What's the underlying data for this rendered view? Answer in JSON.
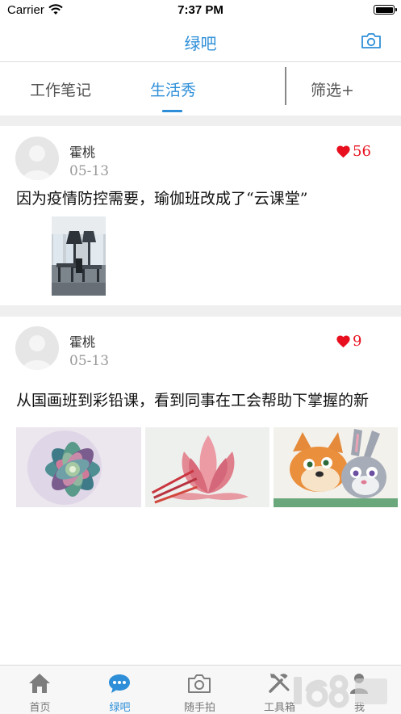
{
  "status_bar": {
    "carrier": "Carrier",
    "time": "7:37 PM"
  },
  "nav": {
    "title": "绿吧",
    "camera_icon": "camera-icon"
  },
  "tabs": {
    "items": [
      {
        "label": "工作笔记"
      },
      {
        "label": "生活秀"
      }
    ],
    "active_index": 1,
    "filter_label": "筛选+"
  },
  "posts": [
    {
      "author": "霍桃",
      "date": "05-13",
      "likes": "56",
      "content": "因为疫情防控需要，瑜伽班改成了“云课堂”"
    },
    {
      "author": "霍桃",
      "date": "05-13",
      "likes": "9",
      "content": "从国画班到彩铅课，看到同事在工会帮助下掌握的新"
    }
  ],
  "tabbar": {
    "items": [
      {
        "label": "首页",
        "icon": "home-icon"
      },
      {
        "label": "绿吧",
        "icon": "chat-bubble-icon"
      },
      {
        "label": "随手拍",
        "icon": "camera-icon"
      },
      {
        "label": "工具箱",
        "icon": "tools-icon"
      },
      {
        "label": "我",
        "icon": "user-icon"
      }
    ],
    "active_index": 1
  },
  "colors": {
    "accent": "#2e8fd8",
    "like": "#e8101f",
    "divider": "#efefef"
  }
}
